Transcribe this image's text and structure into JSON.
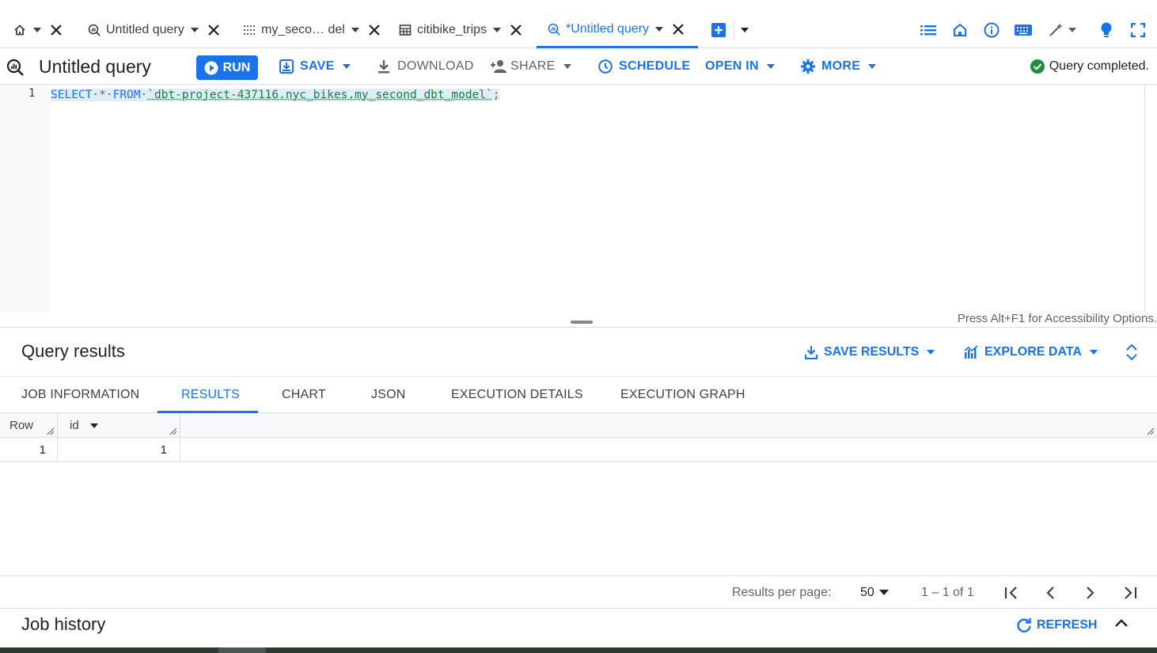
{
  "tabs": [
    {
      "label": "",
      "icon": "home-icon"
    },
    {
      "label": "Untitled query",
      "icon": "query-icon"
    },
    {
      "label": "my_seco… del",
      "icon": "model-icon"
    },
    {
      "label": "citibike_trips",
      "icon": "table-icon"
    },
    {
      "label": "*Untitled query",
      "icon": "query-icon",
      "active": true
    }
  ],
  "header_icons": [
    "list-icon",
    "house-icon",
    "info-icon",
    "keyboard-icon",
    "magic-wand-icon",
    "lightbulb-icon",
    "fullscreen-icon"
  ],
  "toolbar": {
    "title": "Untitled query",
    "run": "RUN",
    "save": "SAVE",
    "download": "DOWNLOAD",
    "share": "SHARE",
    "schedule": "SCHEDULE",
    "open_in": "OPEN IN",
    "more": "MORE",
    "status": "Query completed."
  },
  "editor": {
    "line_number": "1",
    "kw_select": "SELECT",
    "star": "*",
    "kw_from": "FROM",
    "table_ref": "`dbt-project-437116.nyc_bikes.my_second_dbt_model`",
    "semicolon": ";",
    "accessibility_hint": "Press Alt+F1 for Accessibility Options."
  },
  "results": {
    "title": "Query results",
    "save_results": "SAVE RESULTS",
    "explore_data": "EXPLORE DATA",
    "tabs": [
      "JOB INFORMATION",
      "RESULTS",
      "CHART",
      "JSON",
      "EXECUTION DETAILS",
      "EXECUTION GRAPH"
    ],
    "active_tab": "RESULTS",
    "columns": [
      "Row",
      "id"
    ],
    "rows": [
      [
        "1",
        "1"
      ]
    ]
  },
  "pagination": {
    "per_page_label": "Results per page:",
    "per_page_value": "50",
    "range": "1 – 1 of 1"
  },
  "job_history": {
    "title": "Job history",
    "refresh": "REFRESH"
  },
  "colors": {
    "accent": "#1a73e8",
    "success": "#1e8e3e",
    "string": "#188038"
  }
}
